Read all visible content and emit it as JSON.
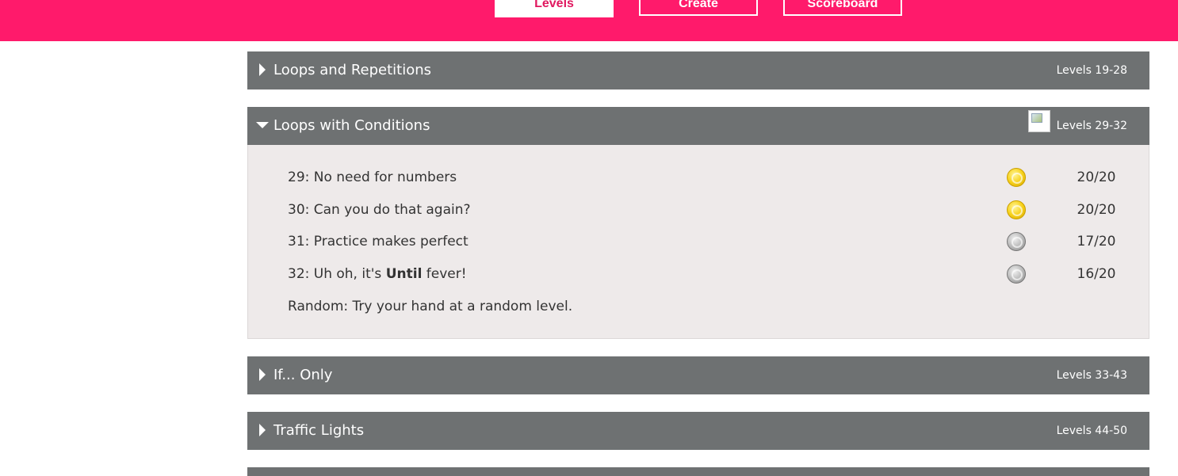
{
  "nav": {
    "levels_label": "Levels",
    "create_label": "Create",
    "scoreboard_label": "Scoreboard"
  },
  "colors": {
    "brand": "#ff1a6b",
    "section_header": "#6e7172",
    "section_body": "#eeeaea"
  },
  "sections": [
    {
      "title": "Loops and Repetitions",
      "range": "Levels 19-28",
      "expanded": false
    },
    {
      "title": "Loops with Conditions",
      "range": "Levels 29-32",
      "expanded": true,
      "levels": [
        {
          "label": "29: No need for numbers",
          "medal": "gold",
          "score": "20/20"
        },
        {
          "label": "30: Can you do that again?",
          "medal": "gold",
          "score": "20/20"
        },
        {
          "label": "31: Practice makes perfect",
          "medal": "silver",
          "score": "17/20"
        },
        {
          "label_prefix": "32: Uh oh, it's ",
          "label_bold": "Until",
          "label_suffix": " fever!",
          "medal": "silver",
          "score": "16/20"
        }
      ],
      "random_label": "Random: Try your hand at a random level."
    },
    {
      "title": "If... Only",
      "range": "Levels 33-43",
      "expanded": false
    },
    {
      "title": "Traffic Lights",
      "range": "Levels 44-50",
      "expanded": false
    }
  ],
  "icons": {
    "expand": "caret-right-icon",
    "collapse": "caret-down-icon",
    "gold_medal": "gold-medal-icon",
    "silver_medal": "silver-medal-icon"
  }
}
